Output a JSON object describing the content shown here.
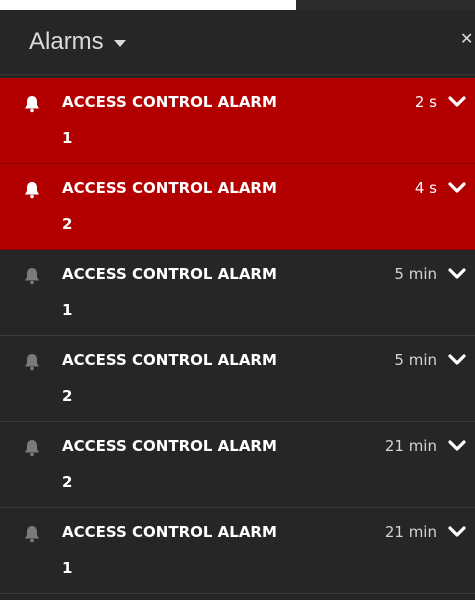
{
  "header": {
    "title": "Alarms"
  },
  "alarms": [
    {
      "name": "ACCESS CONTROL ALARM",
      "id": "1",
      "age": "2 s",
      "state": "active"
    },
    {
      "name": "ACCESS CONTROL ALARM",
      "id": "2",
      "age": "4 s",
      "state": "active"
    },
    {
      "name": "ACCESS CONTROL ALARM",
      "id": "1",
      "age": "5 min",
      "state": "idle"
    },
    {
      "name": "ACCESS CONTROL ALARM",
      "id": "2",
      "age": "5 min",
      "state": "idle"
    },
    {
      "name": "ACCESS CONTROL ALARM",
      "id": "2",
      "age": "21 min",
      "state": "idle"
    },
    {
      "name": "ACCESS CONTROL ALARM",
      "id": "1",
      "age": "21 min",
      "state": "idle"
    }
  ],
  "colors": {
    "active_row": "#b20000",
    "idle_row": "#262626",
    "active_bell": "#ffffff",
    "idle_bell": "#7a7a7a"
  },
  "icons": {
    "row_status": "bell-icon",
    "row_expand": "chevron-down-icon",
    "title_menu": "caret-down-icon",
    "close": "close-icon"
  }
}
